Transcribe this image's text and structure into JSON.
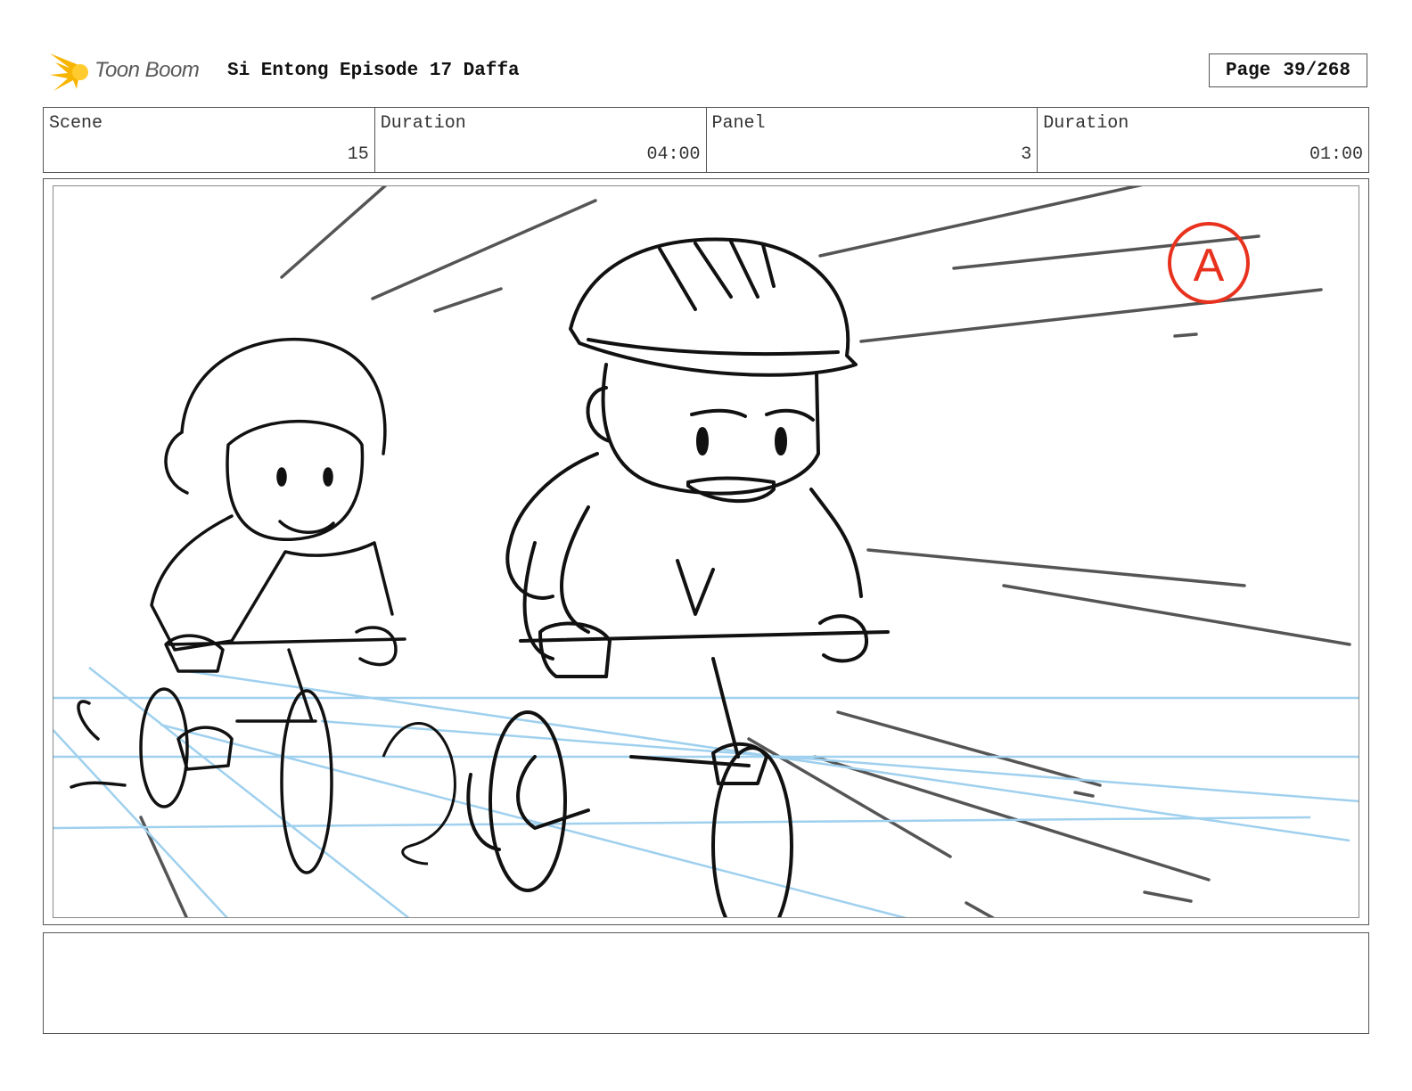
{
  "header": {
    "logo_text": "Toon Boom",
    "title": "Si Entong Episode 17 Daffa",
    "page_label": "Page",
    "page_value": "39/268"
  },
  "info": {
    "scene_label": "Scene",
    "scene_value": "15",
    "duration_label": "Duration",
    "duration_value": "04:00",
    "panel_label": "Panel",
    "panel_value": "3",
    "panel_duration_label": "Duration",
    "panel_duration_value": "01:00"
  },
  "panel": {
    "marker_letter": "A",
    "marker_color": "#e8321e",
    "guide_color": "#9fd0ee"
  },
  "colors": {
    "logo_burst": "#f7b500",
    "ink": "#111111",
    "speed_lines": "#555555"
  }
}
